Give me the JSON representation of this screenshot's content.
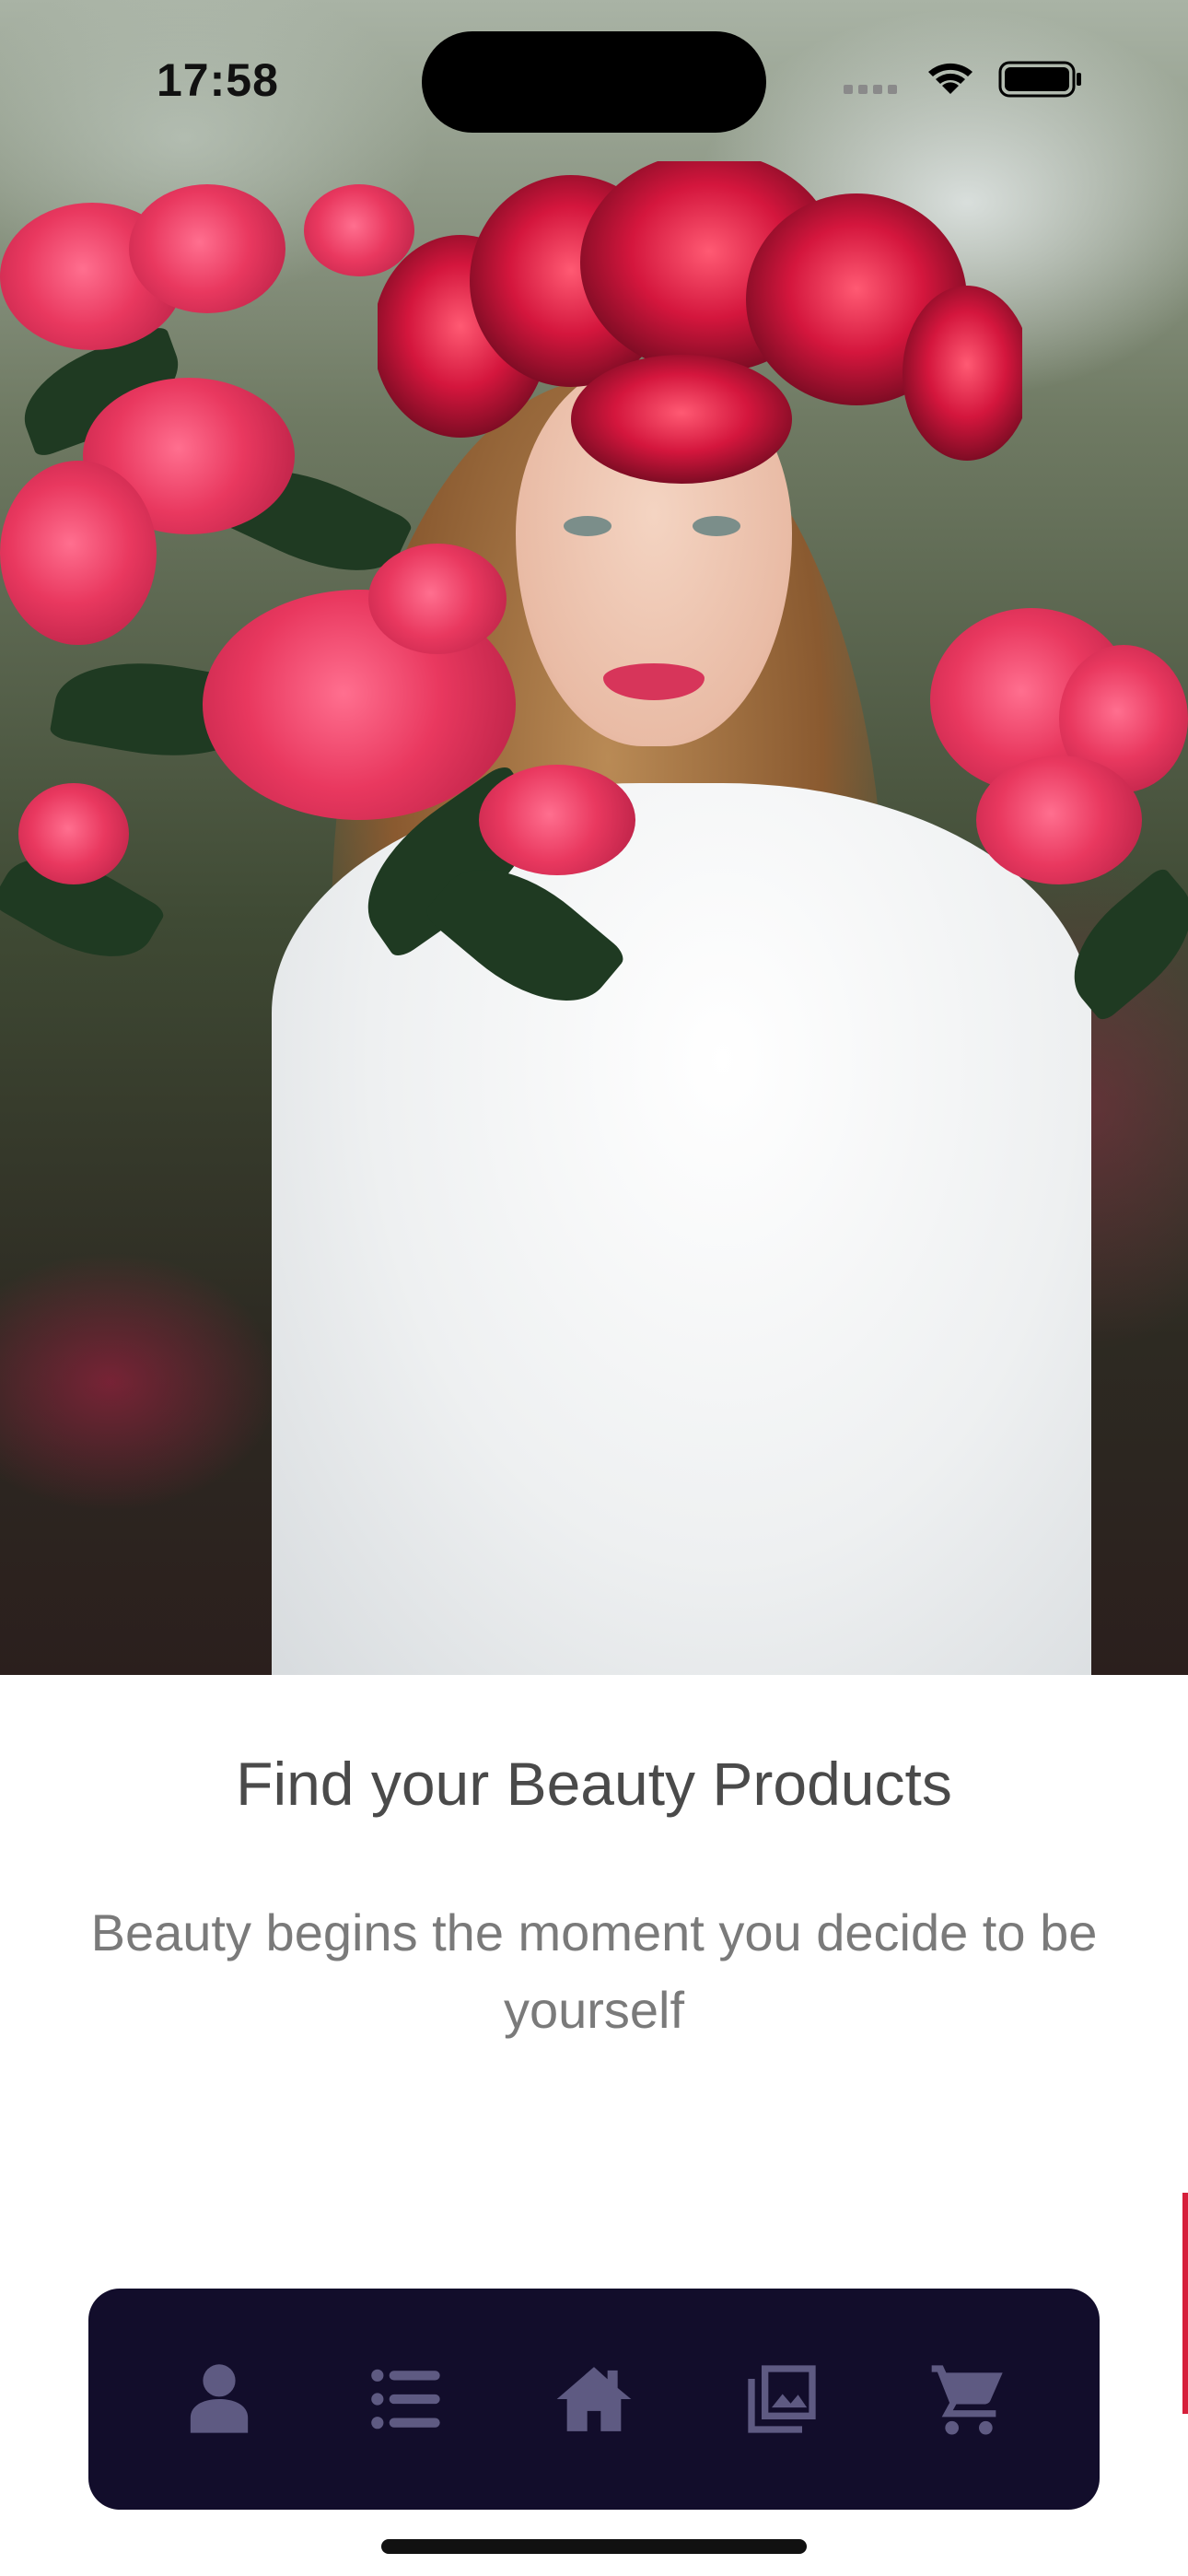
{
  "status_bar": {
    "time": "17:58",
    "icons": [
      "cellular-icon",
      "wifi-icon",
      "battery-icon"
    ]
  },
  "hero": {
    "image_alt": "woman-with-red-flower-crown-photo"
  },
  "content": {
    "title": "Find your Beauty Products",
    "subtitle": "Beauty begins the moment you decide to be yourself"
  },
  "bottom_nav": {
    "items": [
      {
        "icon": "person-icon"
      },
      {
        "icon": "list-icon"
      },
      {
        "icon": "home-icon"
      },
      {
        "icon": "gallery-icon"
      },
      {
        "icon": "cart-icon"
      }
    ],
    "background": "#120d2b",
    "icon_color": "#5e5a82"
  }
}
